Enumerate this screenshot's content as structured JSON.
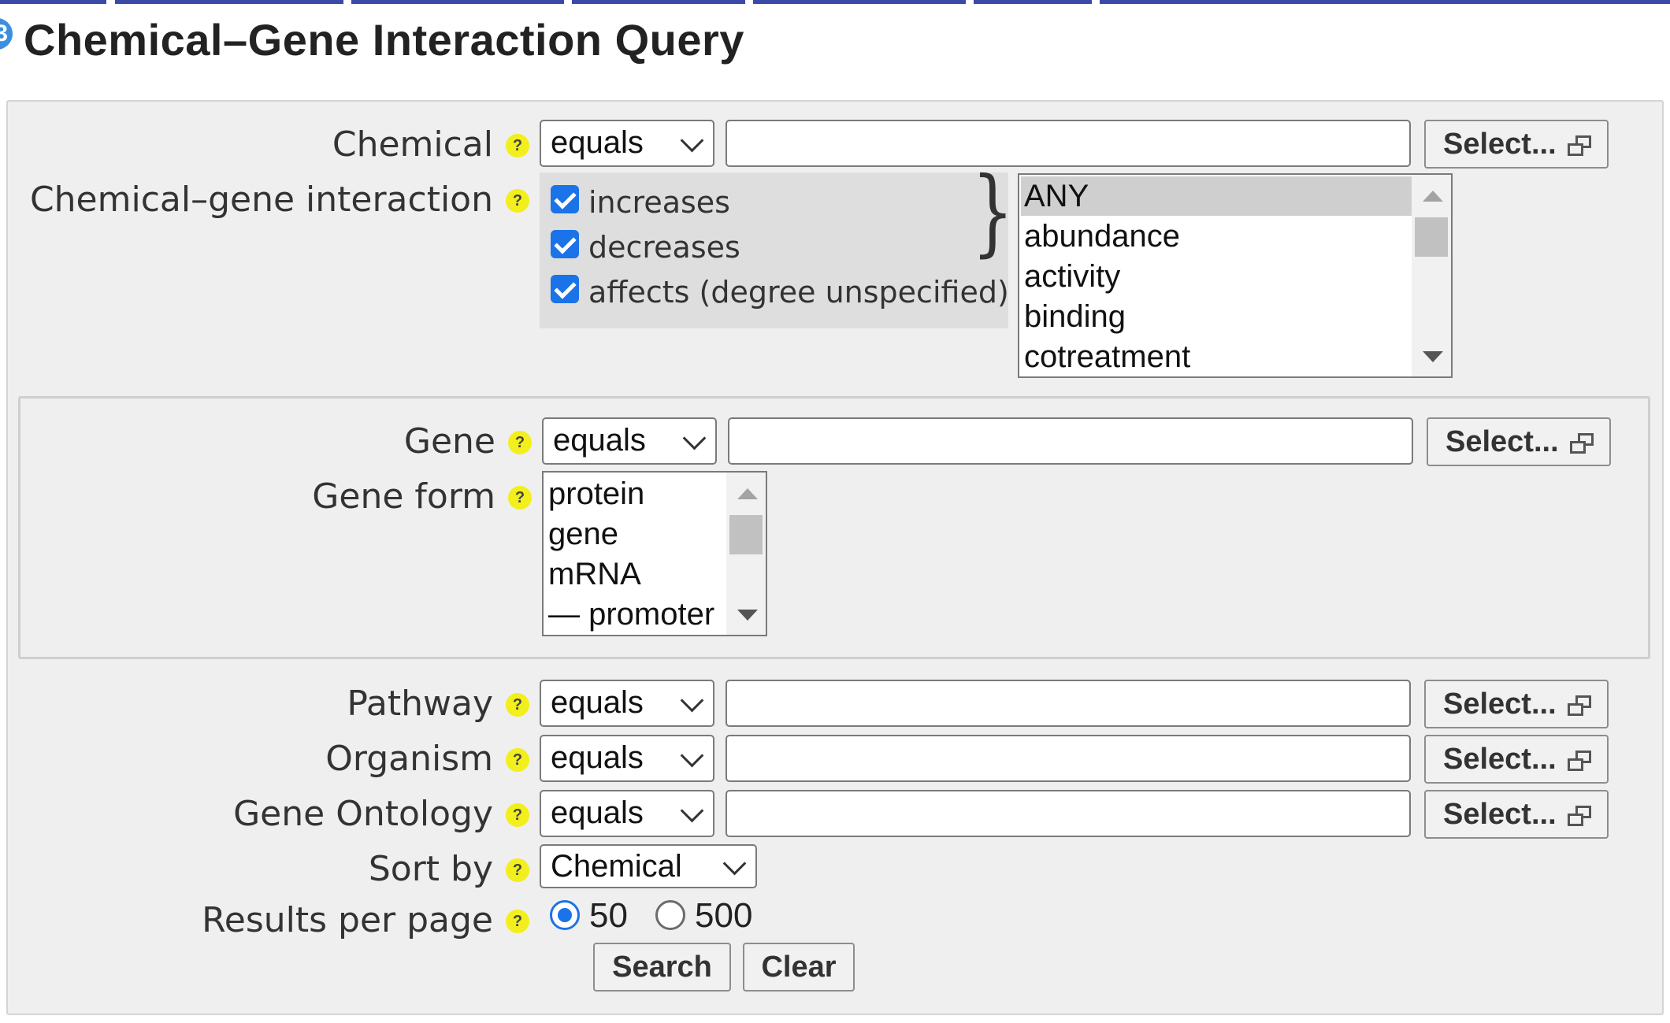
{
  "title": "Chemical–Gene Interaction Query",
  "help_glyph": "?",
  "colors": {
    "accent": "#1a73e8",
    "help_badge": "#f2ef1c",
    "panel": "#efefef",
    "tab_strip": "#3b4aa6"
  },
  "chemical": {
    "label": "Chemical",
    "operator": "equals",
    "value": "",
    "select_button": "Select..."
  },
  "interaction": {
    "label": "Chemical–gene interaction",
    "checkboxes": [
      {
        "label": "increases",
        "checked": true
      },
      {
        "label": "decreases",
        "checked": true
      },
      {
        "label": "affects (degree unspecified)",
        "checked": true
      }
    ],
    "brace": "}",
    "types": [
      "ANY",
      "abundance",
      "activity",
      "binding",
      "cotreatment"
    ],
    "selected_type": "ANY"
  },
  "gene": {
    "label": "Gene",
    "operator": "equals",
    "value": "",
    "select_button": "Select..."
  },
  "gene_form": {
    "label": "Gene form",
    "options": [
      "protein",
      "gene",
      "mRNA",
      "— promoter"
    ]
  },
  "pathway": {
    "label": "Pathway",
    "operator": "equals",
    "value": "",
    "select_button": "Select..."
  },
  "organism": {
    "label": "Organism",
    "operator": "equals",
    "value": "",
    "select_button": "Select..."
  },
  "gene_ontology": {
    "label": "Gene Ontology",
    "operator": "equals",
    "value": "",
    "select_button": "Select..."
  },
  "sort_by": {
    "label": "Sort by",
    "value": "Chemical"
  },
  "results_per_page": {
    "label": "Results per page",
    "options": [
      {
        "label": "50",
        "selected": true
      },
      {
        "label": "500",
        "selected": false
      }
    ]
  },
  "actions": {
    "search": "Search",
    "clear": "Clear"
  }
}
